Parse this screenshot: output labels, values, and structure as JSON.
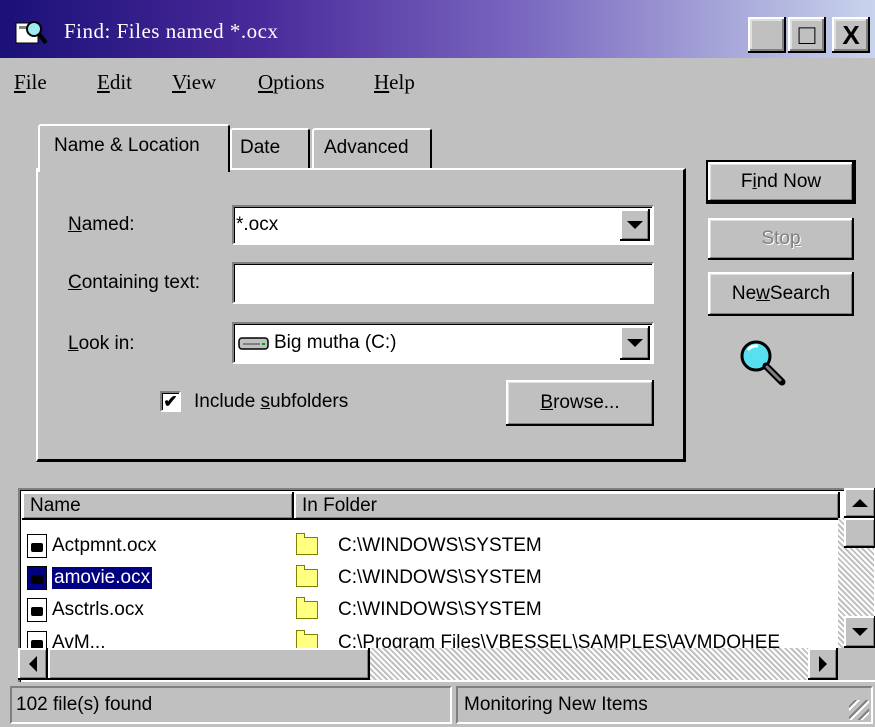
{
  "window": {
    "title": "Find: Files named *.ocx",
    "minimize_glyph": "_",
    "maximize_glyph": "□",
    "close_glyph": "X"
  },
  "menu": [
    {
      "label": "File",
      "accel": "F",
      "rest": "ile"
    },
    {
      "label": "Edit",
      "accel": "E",
      "rest": "dit"
    },
    {
      "label": "View",
      "accel": "V",
      "rest": "iew"
    },
    {
      "label": "Options",
      "accel": "O",
      "rest": "ptions"
    },
    {
      "label": "Help",
      "accel": "H",
      "rest": "elp"
    }
  ],
  "tabs": [
    {
      "label": "Name & Location",
      "active": true
    },
    {
      "label": "Date",
      "active": false
    },
    {
      "label": "Advanced",
      "active": false
    }
  ],
  "form": {
    "named": {
      "accel": "N",
      "rest": "amed:",
      "value": "*.ocx"
    },
    "containing": {
      "accel": "C",
      "rest": "ontaining text:",
      "value": ""
    },
    "lookin": {
      "accel": "L",
      "rest": "ook in:",
      "value": "Big mutha (C:)",
      "icon": "drive-icon"
    },
    "include_subfolders": {
      "before": "Include ",
      "accel": "s",
      "rest": "ubfolders",
      "checked": true,
      "check_glyph": "✔"
    },
    "browse": {
      "accel": "B",
      "rest": "rowse..."
    }
  },
  "buttons": {
    "find_now": {
      "before": "F",
      "accel": "i",
      "rest": "nd Now"
    },
    "stop": {
      "before": "Sto",
      "accel": "p",
      "rest": ""
    },
    "new_search": {
      "before": "Ne",
      "accel": "w",
      "rest": " Search"
    }
  },
  "results": {
    "columns": [
      "Name",
      "In Folder"
    ],
    "rows": [
      {
        "name": "Actpmnt.ocx",
        "folder": "C:\\WINDOWS\\SYSTEM",
        "selected": false
      },
      {
        "name": "amovie.ocx",
        "folder": "C:\\WINDOWS\\SYSTEM",
        "selected": true
      },
      {
        "name": "Asctrls.ocx",
        "folder": "C:\\WINDOWS\\SYSTEM",
        "selected": false
      },
      {
        "name": "AvM...",
        "folder": "C:\\Program Files\\VBESSEL\\SAMPLES\\AVMDOHEE",
        "selected": false
      }
    ]
  },
  "status": {
    "count": "102 file(s) found",
    "monitor": "Monitoring New Items"
  },
  "colors": {
    "title_gradient_start": "#1a1078",
    "title_gradient_end": "#c8d4ec",
    "face": "#c0c0c0",
    "selection": "#000080"
  }
}
